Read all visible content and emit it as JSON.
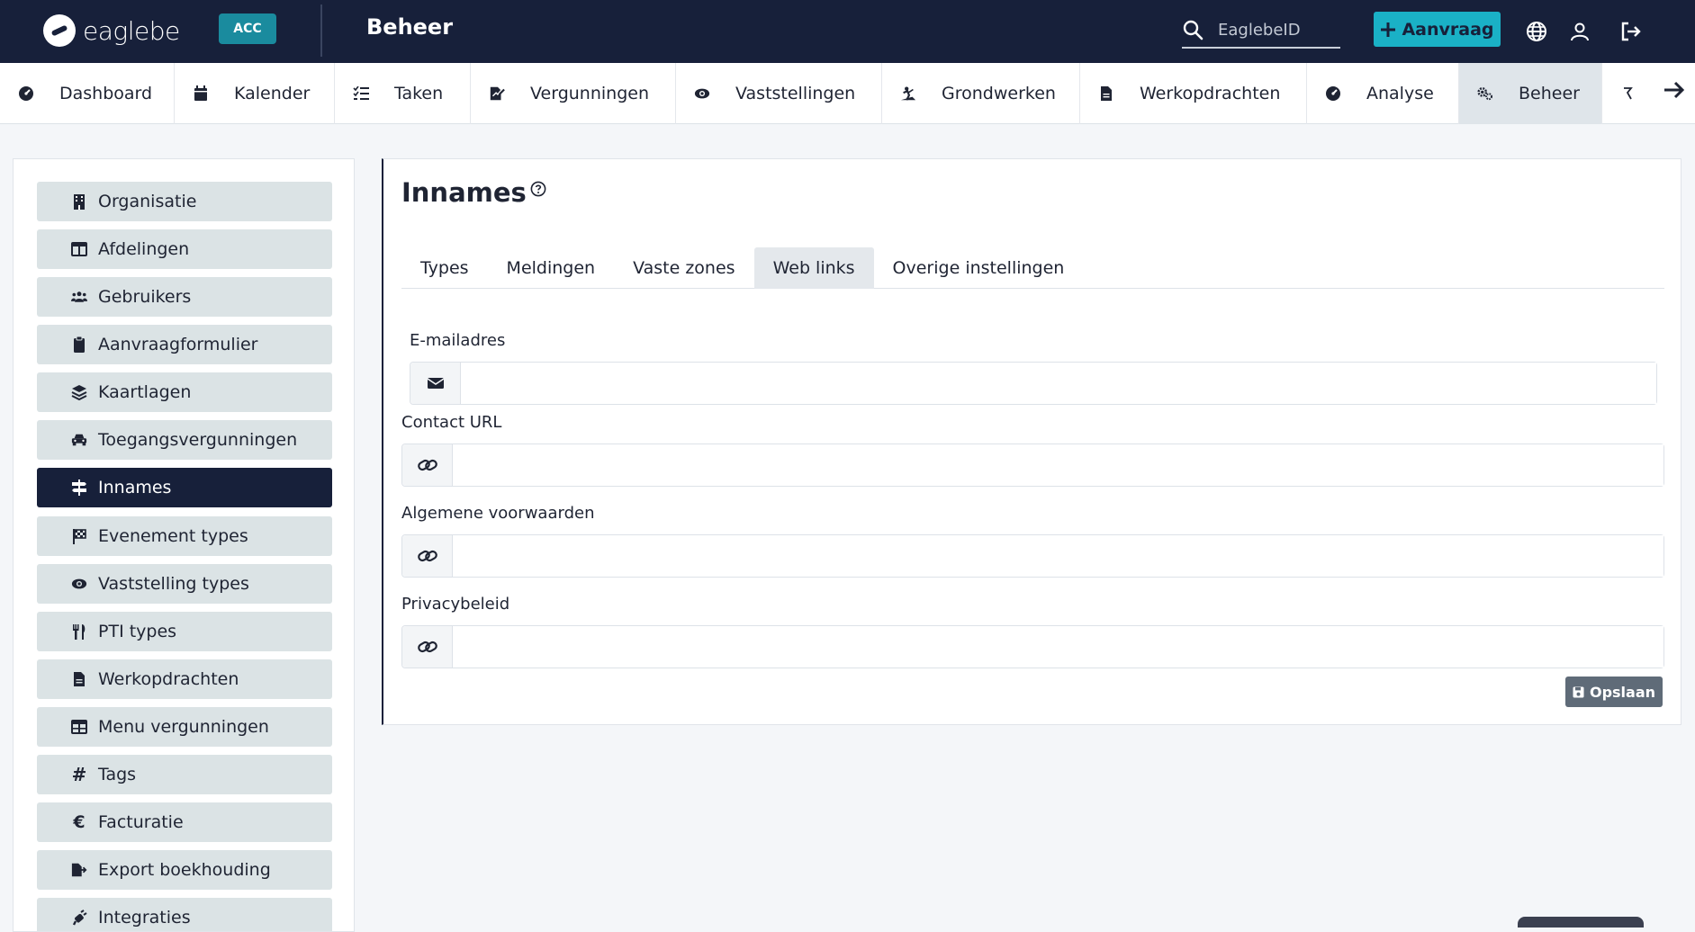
{
  "header": {
    "logo_text": "eaglebe",
    "env_badge": "ACC",
    "section_title": "Beheer",
    "search_placeholder": "EaglebeID",
    "aanvraag_label": "Aanvraag",
    "icons": [
      "globe-icon",
      "user-icon",
      "logout-icon"
    ]
  },
  "nav": {
    "items": [
      {
        "label": "Dashboard",
        "icon": "dashboard-icon"
      },
      {
        "label": "Kalender",
        "icon": "calendar-icon"
      },
      {
        "label": "Taken",
        "icon": "tasks-icon"
      },
      {
        "label": "Vergunningen",
        "icon": "permit-icon"
      },
      {
        "label": "Vaststellingen",
        "icon": "eye-icon"
      },
      {
        "label": "Grondwerken",
        "icon": "digging-icon"
      },
      {
        "label": "Werkopdrachten",
        "icon": "document-icon"
      },
      {
        "label": "Analyse",
        "icon": "analyse-icon"
      },
      {
        "label": "Beheer",
        "icon": "cogs-icon",
        "active": true
      }
    ]
  },
  "sidebar": {
    "items": [
      {
        "label": "Organisatie",
        "icon": "building-icon"
      },
      {
        "label": "Afdelingen",
        "icon": "columns-icon"
      },
      {
        "label": "Gebruikers",
        "icon": "users-icon"
      },
      {
        "label": "Aanvraagformulier",
        "icon": "clipboard-icon"
      },
      {
        "label": "Kaartlagen",
        "icon": "layers-icon"
      },
      {
        "label": "Toegangsvergunningen",
        "icon": "car-icon"
      },
      {
        "label": "Innames",
        "icon": "signpost-icon",
        "active": true
      },
      {
        "label": "Evenement types",
        "icon": "flag-icon"
      },
      {
        "label": "Vaststelling types",
        "icon": "eye-icon"
      },
      {
        "label": "PTI types",
        "icon": "utensils-icon"
      },
      {
        "label": "Werkopdrachten",
        "icon": "document-icon"
      },
      {
        "label": "Menu vergunningen",
        "icon": "table-icon"
      },
      {
        "label": "Tags",
        "icon": "hashtag-icon"
      },
      {
        "label": "Facturatie",
        "icon": "euro-icon"
      },
      {
        "label": "Export boekhouding",
        "icon": "file-export-icon"
      },
      {
        "label": "Integraties",
        "icon": "plug-icon"
      }
    ]
  },
  "main": {
    "title": "Innames",
    "tabs": [
      {
        "label": "Types"
      },
      {
        "label": "Meldingen"
      },
      {
        "label": "Vaste zones"
      },
      {
        "label": "Web links",
        "active": true
      },
      {
        "label": "Overige instellingen"
      }
    ],
    "fields": {
      "email": {
        "label": "E-mailadres",
        "value": ""
      },
      "contact_url": {
        "label": "Contact URL",
        "value": ""
      },
      "terms": {
        "label": "Algemene voorwaarden",
        "value": ""
      },
      "privacy": {
        "label": "Privacybeleid",
        "value": ""
      }
    },
    "save_label": "Opslaan"
  },
  "colors": {
    "header_bg": "#17203a",
    "accent": "#1ab1c6",
    "env_badge": "#1a8b9e",
    "sidebar_item": "#dbe3e5",
    "save_button": "#5f6b78"
  }
}
